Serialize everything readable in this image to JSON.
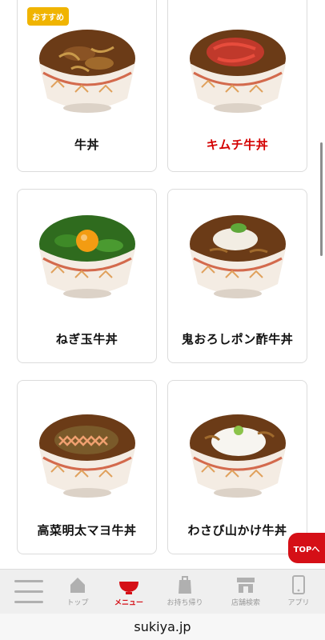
{
  "menu": {
    "items": [
      {
        "name": "牛丼",
        "badge": "おすすめ",
        "highlight": false
      },
      {
        "name": "キムチ牛丼",
        "highlight": true
      },
      {
        "name": "ねぎ玉牛丼",
        "highlight": false
      },
      {
        "name": "鬼おろしポン酢牛丼",
        "highlight": false
      },
      {
        "name": "高菜明太マヨ牛丼",
        "highlight": false
      },
      {
        "name": "わさび山かけ牛丼",
        "highlight": false
      }
    ]
  },
  "top_button": {
    "label": "TOPへ"
  },
  "tabbar": {
    "tabs": [
      {
        "label": "トップ",
        "icon": "home-icon"
      },
      {
        "label": "メニュー",
        "icon": "bowl-icon",
        "active": true
      },
      {
        "label": "お持ち帰り",
        "icon": "takeout-bag-icon"
      },
      {
        "label": "店舗検索",
        "icon": "store-icon"
      },
      {
        "label": "アプリ",
        "icon": "smartphone-icon"
      }
    ]
  },
  "browser": {
    "url": "sukiya.jp"
  },
  "colors": {
    "accent": "#d50f16",
    "badge": "#f0b400",
    "kimchi_label": "#d40000"
  }
}
